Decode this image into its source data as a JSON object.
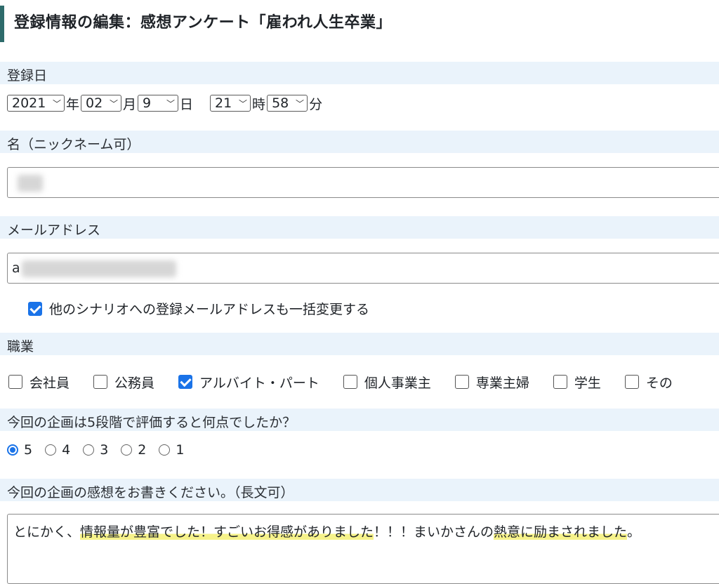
{
  "page": {
    "title": "登録情報の編集：感想アンケート「雇われ人生卒業」"
  },
  "registration_date": {
    "label": "登録日",
    "year": "2021",
    "year_unit": "年",
    "month": "02",
    "month_unit": "月",
    "day": "9",
    "day_unit": "日",
    "hour": "21",
    "hour_unit": "時",
    "minute": "58",
    "minute_unit": "分"
  },
  "name_field": {
    "label": "名（ニックネーム可）"
  },
  "email_field": {
    "label": "メールアドレス",
    "visible_prefix": "a",
    "bulk_change_label": "他のシナリオへの登録メールアドレスも一括変更する",
    "bulk_change_checked": true
  },
  "occupation": {
    "label": "職業",
    "options": [
      {
        "label": "会社員",
        "checked": false
      },
      {
        "label": "公務員",
        "checked": false
      },
      {
        "label": "アルバイト・パート",
        "checked": true
      },
      {
        "label": "個人事業主",
        "checked": false
      },
      {
        "label": "専業主婦",
        "checked": false
      },
      {
        "label": "学生",
        "checked": false
      },
      {
        "label": "その",
        "checked": false
      }
    ]
  },
  "rating": {
    "label": "今回の企画は5段階で評価すると何点でしたか？",
    "options": [
      "5",
      "4",
      "3",
      "2",
      "1"
    ],
    "selected": "5"
  },
  "impressions": {
    "label": "今回の企画の感想をお書きください。（長文可）",
    "text_parts": [
      "とにかく、",
      "情報量が豊富でした！すごいお得感がありました",
      "！！！まいかさんの",
      "熱意に励まされました",
      "。"
    ]
  },
  "colors": {
    "accent": "#2e6b6b",
    "section_bg": "#eaf3fb",
    "check_blue": "#1a73e8",
    "highlight": "#f6f28a"
  }
}
